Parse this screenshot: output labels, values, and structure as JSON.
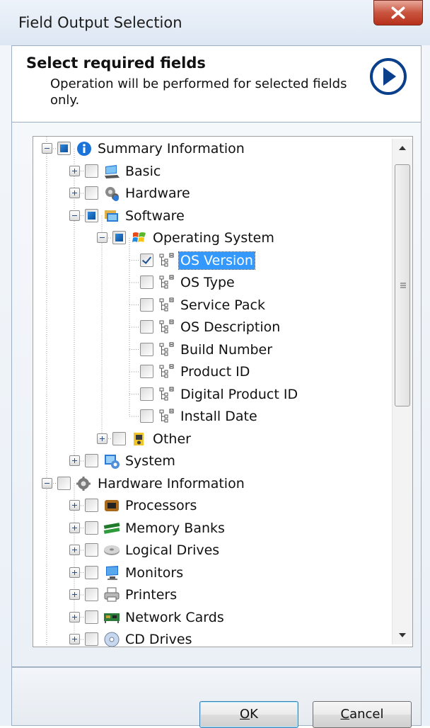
{
  "window": {
    "title": "Field Output Selection"
  },
  "header": {
    "title": "Select required fields",
    "subtitle": "Operation will be performed for selected fields only."
  },
  "tree": {
    "nodes": [
      {
        "label": "Summary Information",
        "level": 0,
        "expander": "minus",
        "check": "partial",
        "icon": "info-icon"
      },
      {
        "label": "Basic",
        "level": 1,
        "expander": "plus",
        "check": "unchecked",
        "icon": "computer-icon"
      },
      {
        "label": "Hardware",
        "level": 1,
        "expander": "plus",
        "check": "unchecked",
        "icon": "hardware-gears-icon"
      },
      {
        "label": "Software",
        "level": 1,
        "expander": "minus",
        "check": "partial",
        "icon": "software-icon"
      },
      {
        "label": "Operating System",
        "level": 2,
        "expander": "minus",
        "check": "partial",
        "icon": "windows-logo-icon"
      },
      {
        "label": "OS Version",
        "level": 3,
        "expander": "none",
        "check": "checked",
        "icon": "field-tree-icon",
        "selected": true
      },
      {
        "label": "OS Type",
        "level": 3,
        "expander": "none",
        "check": "unchecked",
        "icon": "field-tree-icon"
      },
      {
        "label": "Service Pack",
        "level": 3,
        "expander": "none",
        "check": "unchecked",
        "icon": "field-tree-icon"
      },
      {
        "label": "OS Description",
        "level": 3,
        "expander": "none",
        "check": "unchecked",
        "icon": "field-tree-icon"
      },
      {
        "label": "Build Number",
        "level": 3,
        "expander": "none",
        "check": "unchecked",
        "icon": "field-tree-icon"
      },
      {
        "label": "Product ID",
        "level": 3,
        "expander": "none",
        "check": "unchecked",
        "icon": "field-tree-icon"
      },
      {
        "label": "Digital Product ID",
        "level": 3,
        "expander": "none",
        "check": "unchecked",
        "icon": "field-tree-icon"
      },
      {
        "label": "Install Date",
        "level": 3,
        "expander": "none",
        "check": "unchecked",
        "icon": "field-tree-icon"
      },
      {
        "label": "Other",
        "level": 2,
        "expander": "plus",
        "check": "unchecked",
        "icon": "other-folder-icon"
      },
      {
        "label": "System",
        "level": 1,
        "expander": "plus",
        "check": "unchecked",
        "icon": "system-icon"
      },
      {
        "label": "Hardware Information",
        "level": 0,
        "expander": "minus",
        "check": "unchecked",
        "icon": "hardware-info-gear-icon"
      },
      {
        "label": "Processors",
        "level": 1,
        "expander": "plus",
        "check": "unchecked",
        "icon": "processor-icon"
      },
      {
        "label": "Memory Banks",
        "level": 1,
        "expander": "plus",
        "check": "unchecked",
        "icon": "memory-icon"
      },
      {
        "label": "Logical Drives",
        "level": 1,
        "expander": "plus",
        "check": "unchecked",
        "icon": "drive-icon"
      },
      {
        "label": "Monitors",
        "level": 1,
        "expander": "plus",
        "check": "unchecked",
        "icon": "monitor-icon"
      },
      {
        "label": "Printers",
        "level": 1,
        "expander": "plus",
        "check": "unchecked",
        "icon": "printer-icon"
      },
      {
        "label": "Network Cards",
        "level": 1,
        "expander": "plus",
        "check": "unchecked",
        "icon": "network-card-icon"
      },
      {
        "label": "CD Drives",
        "level": 1,
        "expander": "plus",
        "check": "unchecked",
        "icon": "cd-drive-icon"
      }
    ]
  },
  "buttons": {
    "ok": {
      "mnemonic": "O",
      "rest": "K"
    },
    "cancel": {
      "mnemonic": "C",
      "rest": "ancel"
    }
  },
  "colors": {
    "selection": "#3399ff",
    "accent": "#0c4e9a",
    "close": "#c9543e"
  }
}
